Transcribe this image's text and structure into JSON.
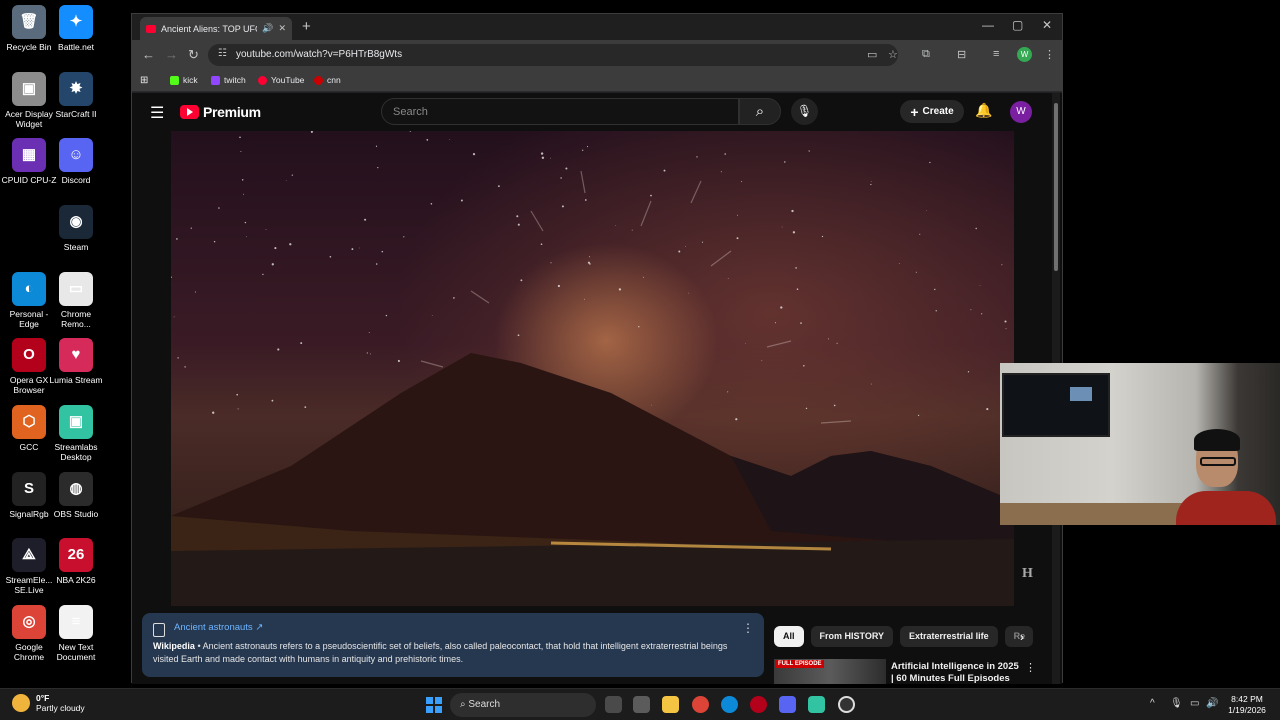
{
  "desktop": {
    "icons": [
      {
        "label": "Recycle Bin",
        "glyph": "🗑",
        "color": "#5a6b7d"
      },
      {
        "label": "Battle.net",
        "glyph": "✦",
        "color": "#148eff"
      },
      {
        "label": "Acer Display Widget",
        "glyph": "▣",
        "color": "#8c8c8c"
      },
      {
        "label": "StarCraft II",
        "glyph": "✸",
        "color": "#24466b"
      },
      {
        "label": "CPUID CPU-Z",
        "glyph": "▦",
        "color": "#6b2fb3"
      },
      {
        "label": "Discord",
        "glyph": "☺",
        "color": "#5865f2"
      },
      {
        "label": "Steam",
        "glyph": "◉",
        "color": "#1b2838"
      },
      {
        "label": "Personal - Edge",
        "glyph": "◐",
        "color": "#0c8ad8"
      },
      {
        "label": "Chrome Remo...",
        "glyph": "▭",
        "color": "#e8e8e8"
      },
      {
        "label": "Opera GX Browser",
        "glyph": "O",
        "color": "#b3001b"
      },
      {
        "label": "Lumia Stream",
        "glyph": "♥",
        "color": "#d62b5a"
      },
      {
        "label": "GCC",
        "glyph": "⬡",
        "color": "#e0631f"
      },
      {
        "label": "Streamlabs Desktop",
        "glyph": "▣",
        "color": "#31c3a2"
      },
      {
        "label": "SignalRgb",
        "glyph": "S",
        "color": "#222"
      },
      {
        "label": "OBS Studio",
        "glyph": "◍",
        "color": "#2b2b2b"
      },
      {
        "label": "StreamEle... SE.Live",
        "glyph": "⟁",
        "color": "#1e1e2a"
      },
      {
        "label": "NBA 2K26",
        "glyph": "26",
        "color": "#c8102e"
      },
      {
        "label": "Google Chrome",
        "glyph": "◎",
        "color": "#db4437"
      },
      {
        "label": "New Text Document",
        "glyph": "≡",
        "color": "#f2f2f2"
      }
    ]
  },
  "browser": {
    "tab_title": "Ancient Aliens: TOP UFO M",
    "url": "youtube.com/watch?v=P6HTrB8gWts",
    "bookmarks": [
      {
        "label": "kick",
        "color": "#53fc18"
      },
      {
        "label": "twitch",
        "color": "#9146ff"
      },
      {
        "label": "YouTube",
        "color": "#ff0033"
      },
      {
        "label": "cnn",
        "color": "#cc0000"
      }
    ],
    "profile_initial": "W"
  },
  "youtube": {
    "logo_word": "Premium",
    "search_placeholder": "Search",
    "create_label": "Create",
    "avatar_initial": "W",
    "watermark": "H",
    "info_card": {
      "topic": "Ancient astronauts ↗",
      "source": "Wikipedia",
      "text": " • Ancient astronauts refers to a pseudoscientific set of beliefs, also called paleocontact, that hold that intelligent extraterrestrial beings visited Earth and made contact with humans in antiquity and prehistoric times."
    },
    "chips": [
      "All",
      "From HISTORY",
      "Extraterrestrial life",
      "Re"
    ],
    "recommendation": {
      "badge": "FULL EPISODE",
      "title": "Artificial Intelligence in 2025 | 60 Minutes Full Episodes"
    }
  },
  "taskbar": {
    "weather_temp": "0°F",
    "weather_desc": "Partly cloudy",
    "search_label": "Search",
    "time": "8:42 PM",
    "date": "1/19/2026"
  }
}
